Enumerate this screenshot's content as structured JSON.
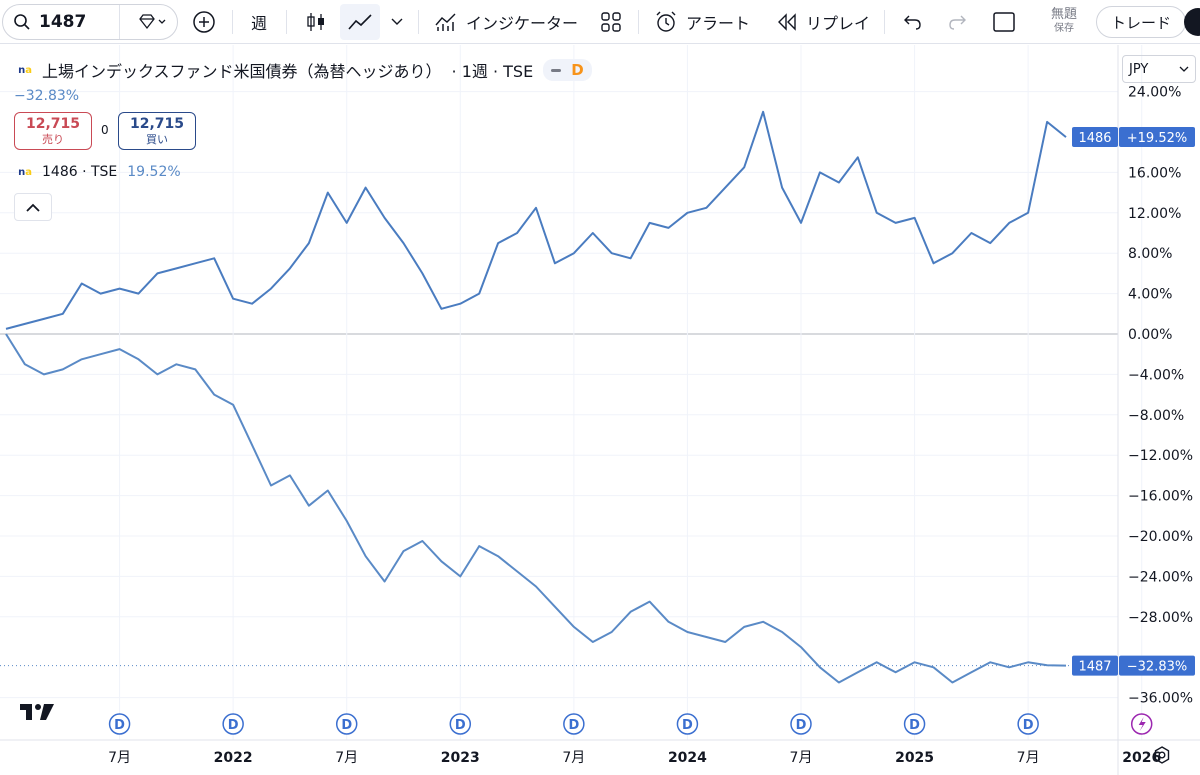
{
  "toolbar": {
    "symbol": "1487",
    "interval": "週",
    "indicators_label": "インジケーター",
    "alert_label": "アラート",
    "replay_label": "リプレイ",
    "save_title": "無題",
    "save_sub": "保存",
    "trade_label": "トレード"
  },
  "legend": {
    "title": "上場インデックスファンド米国債券（為替ヘッジあり）",
    "suffix": "· 1週 · TSE",
    "logo_n": "n",
    "logo_a": "a",
    "pill_d": "D",
    "change": "−32.83%",
    "sell_price": "12,715",
    "sell_label": "売り",
    "spread": "0",
    "buy_price": "12,715",
    "buy_label": "買い",
    "compare_symbol": "1486 · TSE",
    "compare_change": "19.52%"
  },
  "scale": {
    "currency": "JPY"
  },
  "chart_data": {
    "type": "line",
    "y_unit": "%",
    "ylim": [
      -38,
      25
    ],
    "y_ticks": [
      24,
      16,
      12,
      8,
      4,
      0,
      -4,
      -8,
      -12,
      -16,
      -20,
      -24,
      -28,
      -36
    ],
    "y_tick_labels": [
      "24.00%",
      "16.00%",
      "12.00%",
      "8.00%",
      "4.00%",
      "0.00%",
      "−4.00%",
      "−8.00%",
      "−12.00%",
      "−16.00%",
      "−20.00%",
      "−24.00%",
      "−28.00%",
      "−36.00%"
    ],
    "x_ticks": [
      "2021-07",
      "2022-01",
      "2022-07",
      "2023-01",
      "2023-07",
      "2024-01",
      "2024-07",
      "2025-01",
      "2025-07",
      "2026-01"
    ],
    "x_tick_labels": [
      "7月",
      "2022",
      "7月",
      "2023",
      "7月",
      "2024",
      "7月",
      "2025",
      "7月",
      "2026"
    ],
    "x_tick_bold": [
      false,
      true,
      false,
      true,
      false,
      true,
      false,
      true,
      false,
      true
    ],
    "dividend_markers": [
      "2021-07",
      "2022-01",
      "2022-07",
      "2023-01",
      "2023-07",
      "2024-01",
      "2024-07",
      "2025-01",
      "2025-07"
    ],
    "dividend_label": "D",
    "series": [
      {
        "name": "1486",
        "color": "#4a7cc0",
        "last_label": "+19.52%",
        "points": [
          [
            "2021-01",
            0.5
          ],
          [
            "2021-02",
            1
          ],
          [
            "2021-03",
            1.5
          ],
          [
            "2021-04",
            2
          ],
          [
            "2021-05",
            5
          ],
          [
            "2021-06",
            4
          ],
          [
            "2021-07",
            4.5
          ],
          [
            "2021-08",
            4
          ],
          [
            "2021-09",
            6
          ],
          [
            "2021-10",
            6.5
          ],
          [
            "2021-11",
            7
          ],
          [
            "2021-12",
            7.5
          ],
          [
            "2022-01",
            3.5
          ],
          [
            "2022-02",
            3
          ],
          [
            "2022-03",
            4.5
          ],
          [
            "2022-04",
            6.5
          ],
          [
            "2022-05",
            9
          ],
          [
            "2022-06",
            14
          ],
          [
            "2022-07",
            11
          ],
          [
            "2022-08",
            14.5
          ],
          [
            "2022-09",
            11.5
          ],
          [
            "2022-10",
            9
          ],
          [
            "2022-11",
            6
          ],
          [
            "2022-12",
            2.5
          ],
          [
            "2023-01",
            3
          ],
          [
            "2023-02",
            4
          ],
          [
            "2023-03",
            9
          ],
          [
            "2023-04",
            10
          ],
          [
            "2023-05",
            12.5
          ],
          [
            "2023-06",
            7
          ],
          [
            "2023-07",
            8
          ],
          [
            "2023-08",
            10
          ],
          [
            "2023-09",
            8
          ],
          [
            "2023-10",
            7.5
          ],
          [
            "2023-11",
            11
          ],
          [
            "2023-12",
            10.5
          ],
          [
            "2024-01",
            12
          ],
          [
            "2024-02",
            12.5
          ],
          [
            "2024-03",
            14.5
          ],
          [
            "2024-04",
            16.5
          ],
          [
            "2024-05",
            22
          ],
          [
            "2024-06",
            14.5
          ],
          [
            "2024-07",
            11
          ],
          [
            "2024-08",
            16
          ],
          [
            "2024-09",
            15
          ],
          [
            "2024-10",
            17.5
          ],
          [
            "2024-11",
            12
          ],
          [
            "2024-12",
            11
          ],
          [
            "2025-01",
            11.5
          ],
          [
            "2025-02",
            7
          ],
          [
            "2025-03",
            8
          ],
          [
            "2025-04",
            10
          ],
          [
            "2025-05",
            9
          ],
          [
            "2025-06",
            11
          ],
          [
            "2025-07",
            12
          ],
          [
            "2025-08",
            21
          ],
          [
            "2025-09",
            19.5
          ]
        ]
      },
      {
        "name": "1487",
        "color": "#5a8ac6",
        "last_label": "−32.83%",
        "points": [
          [
            "2021-01",
            0
          ],
          [
            "2021-02",
            -3
          ],
          [
            "2021-03",
            -4
          ],
          [
            "2021-04",
            -3.5
          ],
          [
            "2021-05",
            -2.5
          ],
          [
            "2021-06",
            -2
          ],
          [
            "2021-07",
            -1.5
          ],
          [
            "2021-08",
            -2.5
          ],
          [
            "2021-09",
            -4
          ],
          [
            "2021-10",
            -3
          ],
          [
            "2021-11",
            -3.5
          ],
          [
            "2021-12",
            -6
          ],
          [
            "2022-01",
            -7
          ],
          [
            "2022-02",
            -11
          ],
          [
            "2022-03",
            -15
          ],
          [
            "2022-04",
            -14
          ],
          [
            "2022-05",
            -17
          ],
          [
            "2022-06",
            -15.5
          ],
          [
            "2022-07",
            -18.5
          ],
          [
            "2022-08",
            -22
          ],
          [
            "2022-09",
            -24.5
          ],
          [
            "2022-10",
            -21.5
          ],
          [
            "2022-11",
            -20.5
          ],
          [
            "2022-12",
            -22.5
          ],
          [
            "2023-01",
            -24
          ],
          [
            "2023-02",
            -21
          ],
          [
            "2023-03",
            -22
          ],
          [
            "2023-04",
            -23.5
          ],
          [
            "2023-05",
            -25
          ],
          [
            "2023-06",
            -27
          ],
          [
            "2023-07",
            -29
          ],
          [
            "2023-08",
            -30.5
          ],
          [
            "2023-09",
            -29.5
          ],
          [
            "2023-10",
            -27.5
          ],
          [
            "2023-11",
            -26.5
          ],
          [
            "2023-12",
            -28.5
          ],
          [
            "2024-01",
            -29.5
          ],
          [
            "2024-02",
            -30
          ],
          [
            "2024-03",
            -30.5
          ],
          [
            "2024-04",
            -29
          ],
          [
            "2024-05",
            -28.5
          ],
          [
            "2024-06",
            -29.5
          ],
          [
            "2024-07",
            -31
          ],
          [
            "2024-08",
            -33
          ],
          [
            "2024-09",
            -34.5
          ],
          [
            "2024-10",
            -33.5
          ],
          [
            "2024-11",
            -32.5
          ],
          [
            "2024-12",
            -33.5
          ],
          [
            "2025-01",
            -32.5
          ],
          [
            "2025-02",
            -33
          ],
          [
            "2025-03",
            -34.5
          ],
          [
            "2025-04",
            -33.5
          ],
          [
            "2025-05",
            -32.5
          ],
          [
            "2025-06",
            -33
          ],
          [
            "2025-07",
            -32.5
          ],
          [
            "2025-08",
            -32.8
          ],
          [
            "2025-09",
            -32.83
          ]
        ]
      }
    ]
  }
}
